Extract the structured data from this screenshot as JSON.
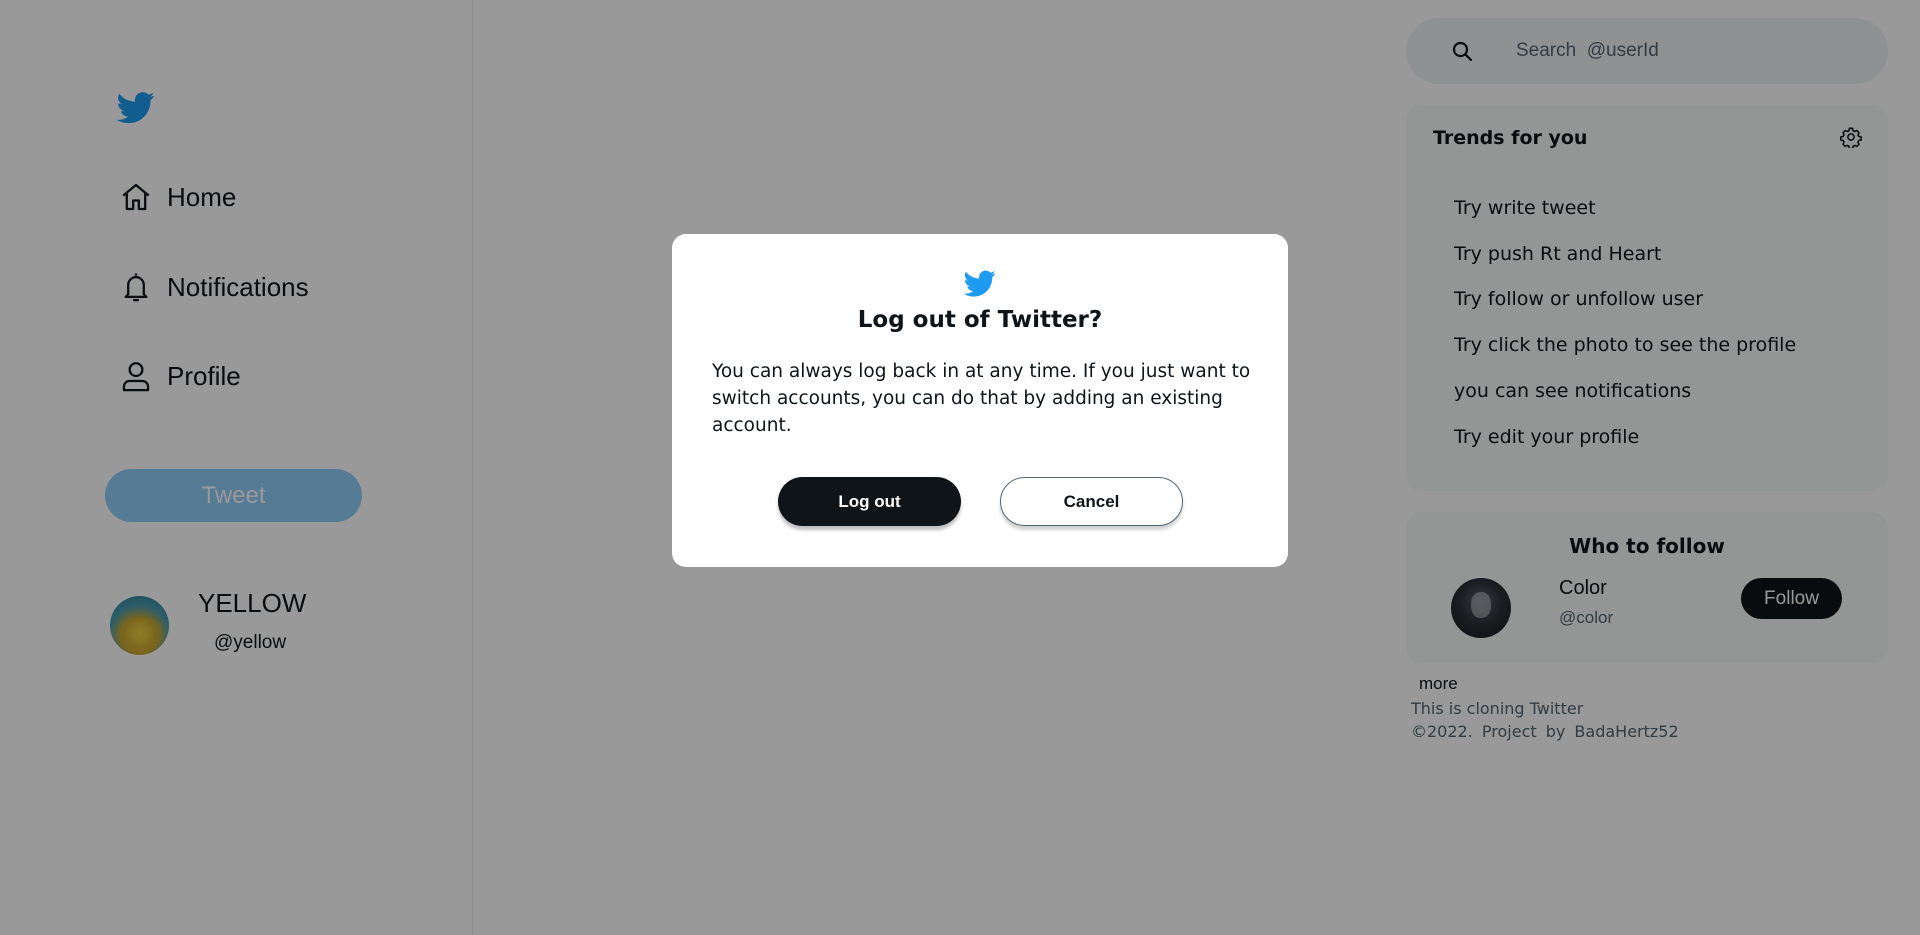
{
  "colors": {
    "brand": "#1d9bf0",
    "tweet_button": "#8ecdf8",
    "dark_button": "#0f1419",
    "overlay": "rgba(0,0,0,0.40)"
  },
  "sidebar": {
    "logo_icon": "twitter-bird-icon",
    "nav": [
      {
        "label": "Home",
        "icon": "home-icon"
      },
      {
        "label": "Notifications",
        "icon": "bell-icon"
      },
      {
        "label": "Profile",
        "icon": "user-icon"
      }
    ],
    "tweet_label": "Tweet",
    "user": {
      "name": "YELLOW",
      "handle": "@yellow"
    }
  },
  "search": {
    "placeholder": "Search  @userId",
    "icon": "search-icon"
  },
  "trends": {
    "title": "Trends for you",
    "settings_icon": "gear-icon",
    "items": [
      "Try write tweet",
      "Try push Rt and Heart",
      "Try follow or unfollow user",
      "Try click the photo to see the profile",
      "you can see notifications",
      "Try edit your profile"
    ]
  },
  "who_to_follow": {
    "title": "Who to follow",
    "users": [
      {
        "name": "Color",
        "handle": "@color",
        "button": "Follow"
      }
    ]
  },
  "footer": {
    "more": "more",
    "line1": "This is cloning Twitter",
    "line2": "©2022. Project by BadaHertz52"
  },
  "modal": {
    "icon": "twitter-bird-icon",
    "title": "Log out of Twitter?",
    "text": "You can always log back in at any time. If you just want to switch accounts, you can do that by adding an existing account.",
    "confirm_label": "Log out",
    "cancel_label": "Cancel"
  }
}
